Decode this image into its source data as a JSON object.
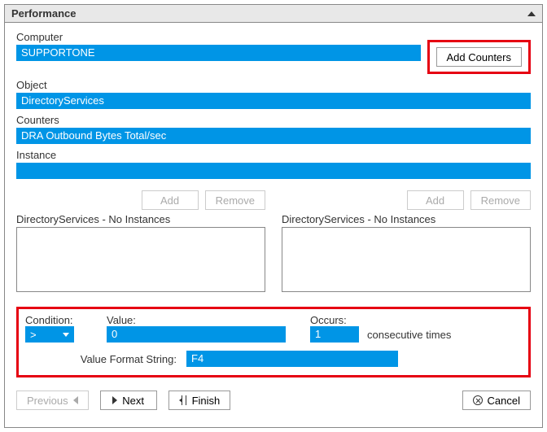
{
  "panel": {
    "title": "Performance"
  },
  "labels": {
    "computer": "Computer",
    "object": "Object",
    "counters": "Counters",
    "instance": "Instance",
    "add_counters": "Add Counters",
    "add": "Add",
    "remove": "Remove",
    "condition": "Condition:",
    "value": "Value:",
    "occurs": "Occurs:",
    "consecutive": "consecutive times",
    "value_format": "Value Format String:",
    "previous": "Previous",
    "next": "Next",
    "finish": "Finish",
    "cancel": "Cancel"
  },
  "fields": {
    "computer": "SUPPORTONE",
    "object": "DirectoryServices",
    "counters": "DRA Outbound Bytes Total/sec",
    "instance": ""
  },
  "lists": {
    "left_caption": "DirectoryServices - No Instances",
    "right_caption": "DirectoryServices - No Instances"
  },
  "condition": {
    "operator": ">",
    "value": "0",
    "occurs": "1",
    "format": "F4"
  }
}
